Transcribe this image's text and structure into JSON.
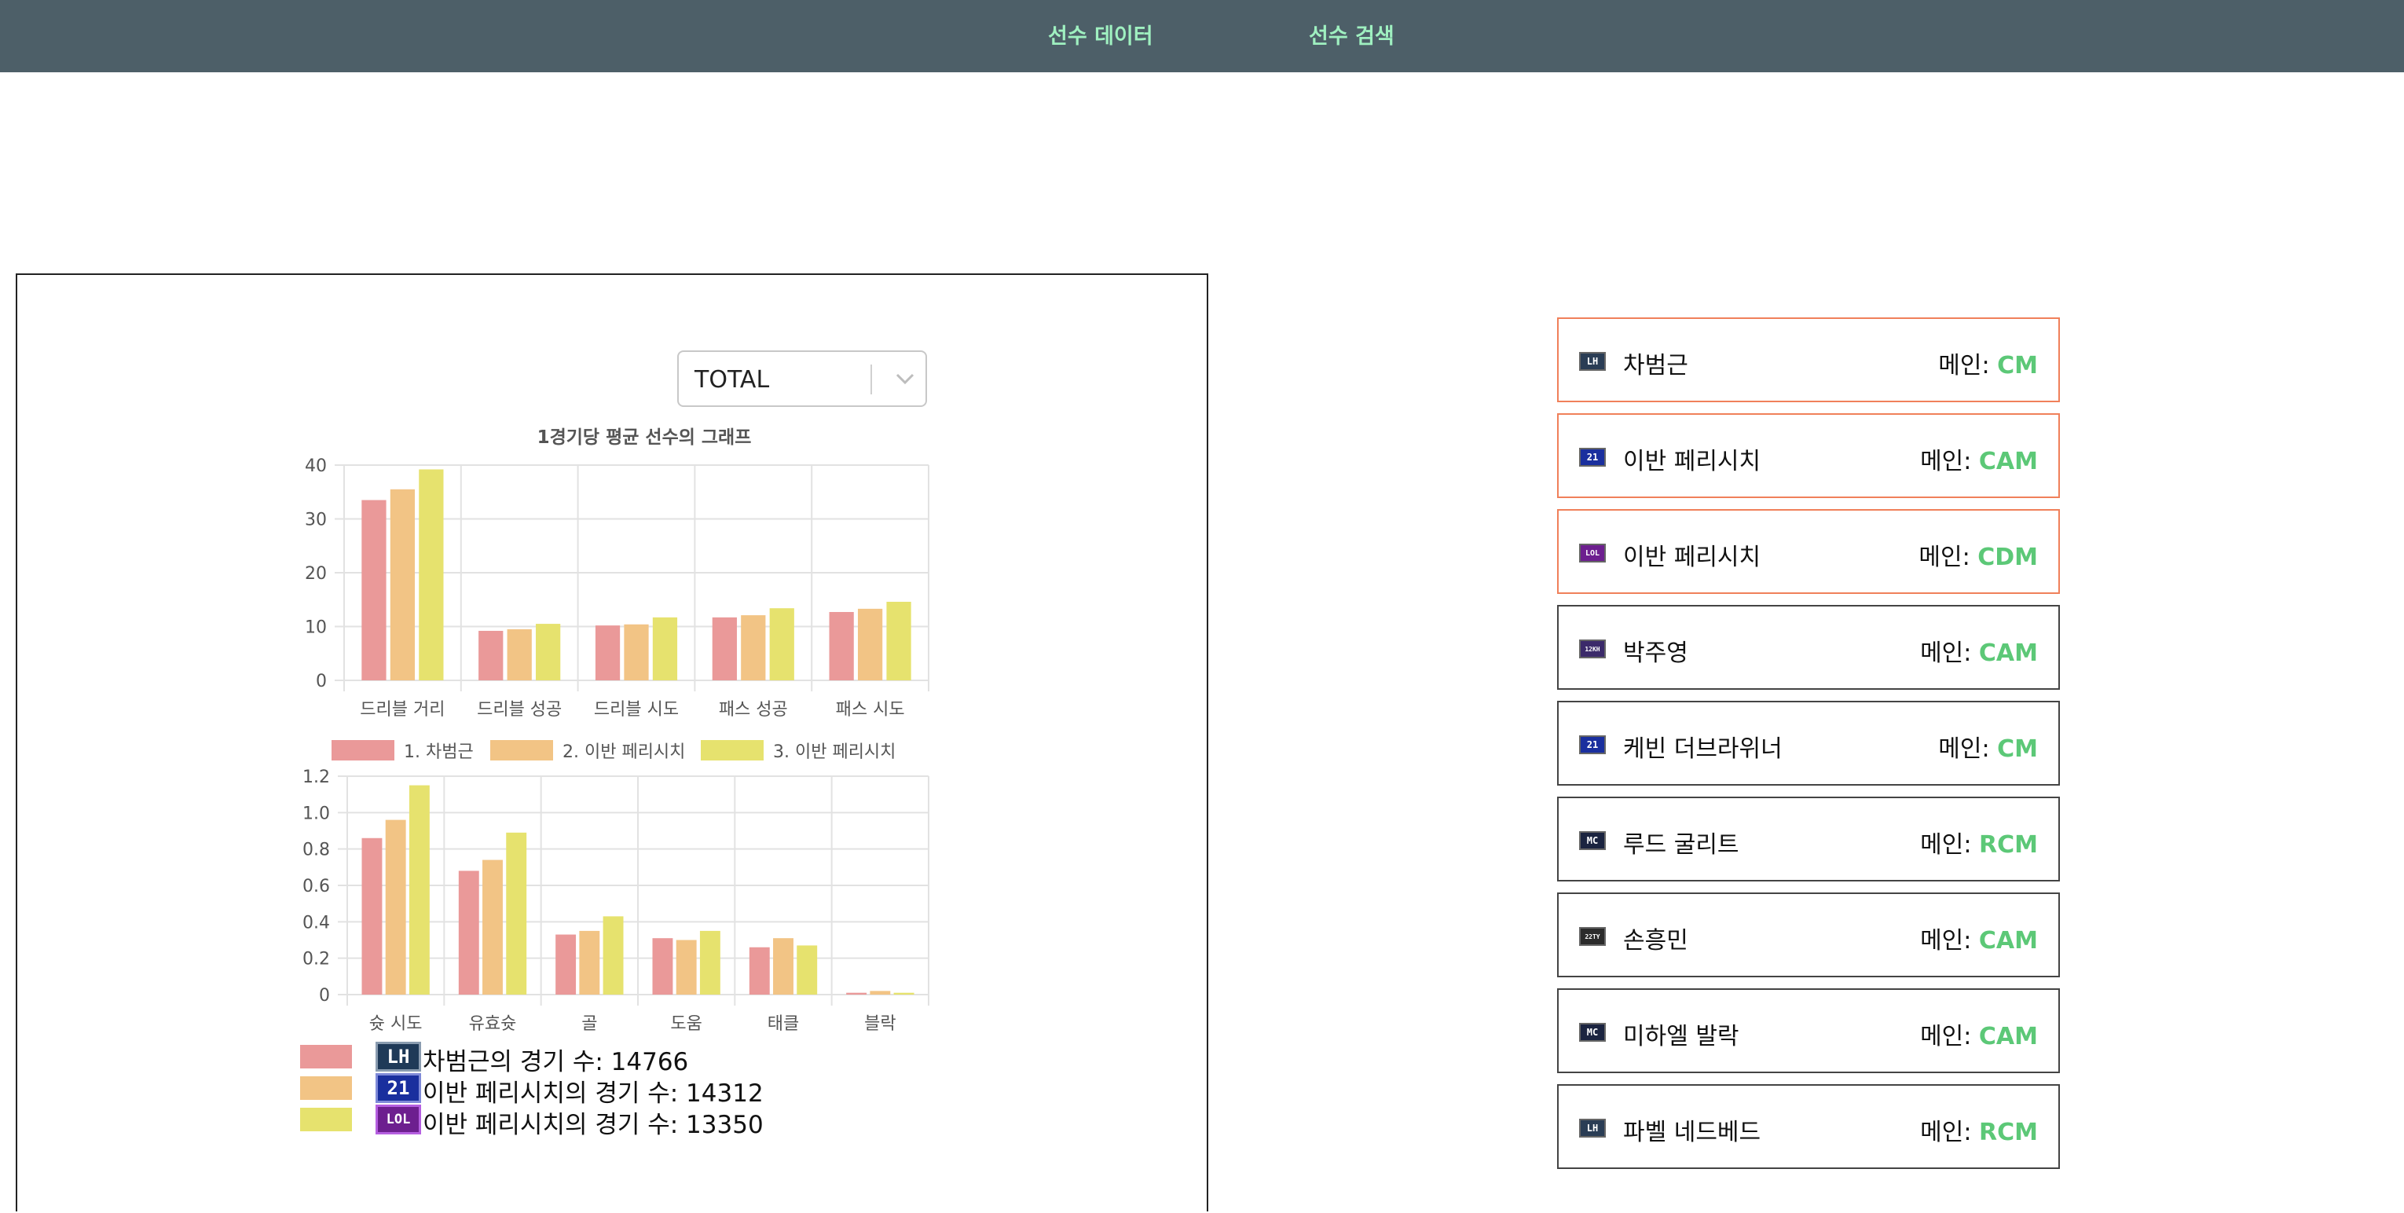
{
  "nav": {
    "items": [
      {
        "label": "선수 데이터"
      },
      {
        "label": "선수 검색"
      }
    ]
  },
  "season_select": {
    "value": "TOTAL"
  },
  "colors": {
    "player1": "#ea9999",
    "player2": "#f2c485",
    "player3": "#e6e26e",
    "accent_green": "#5cc877",
    "selected_border": "#f0805a"
  },
  "chart_data": [
    {
      "type": "bar",
      "title": "1경기당 평균 선수의 그래프",
      "categories": [
        "드리블 거리",
        "드리블 성공",
        "드리블 시도",
        "패스 성공",
        "패스 시도"
      ],
      "series": [
        {
          "name": "1. 차범근",
          "values": [
            33.5,
            9.2,
            10.2,
            11.7,
            12.7
          ]
        },
        {
          "name": "2. 이반 페리시치",
          "values": [
            35.5,
            9.5,
            10.4,
            12.1,
            13.3
          ]
        },
        {
          "name": "3. 이반 페리시치",
          "values": [
            39.2,
            10.5,
            11.7,
            13.4,
            14.6
          ]
        }
      ],
      "ylim": [
        0,
        40
      ],
      "yticks": [
        "0",
        "10",
        "20",
        "30",
        "40"
      ],
      "grid": true,
      "legend": "bottom"
    },
    {
      "type": "bar",
      "title": "",
      "categories": [
        "슛 시도",
        "유효슛",
        "골",
        "도움",
        "태클",
        "블락"
      ],
      "series": [
        {
          "name": "1. 차범근",
          "values": [
            0.86,
            0.68,
            0.33,
            0.31,
            0.26,
            0.01
          ]
        },
        {
          "name": "2. 이반 페리시치",
          "values": [
            0.96,
            0.74,
            0.35,
            0.3,
            0.31,
            0.02
          ]
        },
        {
          "name": "3. 이반 페리시치",
          "values": [
            1.15,
            0.89,
            0.43,
            0.35,
            0.27,
            0.01
          ]
        }
      ],
      "ylim": [
        0,
        1.2
      ],
      "yticks": [
        "0",
        "0.2",
        "0.4",
        "0.6",
        "0.8",
        "1.0",
        "1.2"
      ],
      "grid": true
    }
  ],
  "match_counts": [
    {
      "logo": "LH",
      "logo_bg": "#1f3a58",
      "logo_border": "#8a9cb0",
      "text": "차범근의 경기 수: 14766"
    },
    {
      "logo": "21",
      "logo_bg": "#1a2f9e",
      "logo_border": "#7f8ad8",
      "text": "이반 페리시치의 경기 수: 14312"
    },
    {
      "logo": "LOL",
      "logo_bg": "#6d1f8f",
      "logo_border": "#b55fe0",
      "text": "이반 페리시치의 경기 수: 13350"
    }
  ],
  "players": [
    {
      "badge": "LH",
      "badge_bg": "#2a3d55",
      "name": "차범근",
      "main_label": "메인: ",
      "position": "CM",
      "selected": true
    },
    {
      "badge": "21",
      "badge_bg": "#1a2f9e",
      "name": "이반 페리시치",
      "main_label": "메인: ",
      "position": "CAM",
      "selected": true
    },
    {
      "badge": "LOL",
      "badge_bg": "#6d1f8f",
      "name": "이반 페리시치",
      "main_label": "메인: ",
      "position": "CDM",
      "selected": true
    },
    {
      "badge": "12KH",
      "badge_bg": "#3b2a6a",
      "name": "박주영",
      "main_label": "메인: ",
      "position": "CAM",
      "selected": false
    },
    {
      "badge": "21",
      "badge_bg": "#1a2f9e",
      "name": "케빈 더브라위너",
      "main_label": "메인: ",
      "position": "CM",
      "selected": false
    },
    {
      "badge": "MC",
      "badge_bg": "#1b2440",
      "name": "루드 굴리트",
      "main_label": "메인: ",
      "position": "RCM",
      "selected": false
    },
    {
      "badge": "22TY",
      "badge_bg": "#2b2b2b",
      "name": "손흥민",
      "main_label": "메인: ",
      "position": "CAM",
      "selected": false
    },
    {
      "badge": "MC",
      "badge_bg": "#1b2440",
      "name": "미하엘 발락",
      "main_label": "메인: ",
      "position": "CAM",
      "selected": false
    },
    {
      "badge": "LH",
      "badge_bg": "#2a3d55",
      "name": "파벨 네드베드",
      "main_label": "메인: ",
      "position": "RCM",
      "selected": false
    }
  ]
}
